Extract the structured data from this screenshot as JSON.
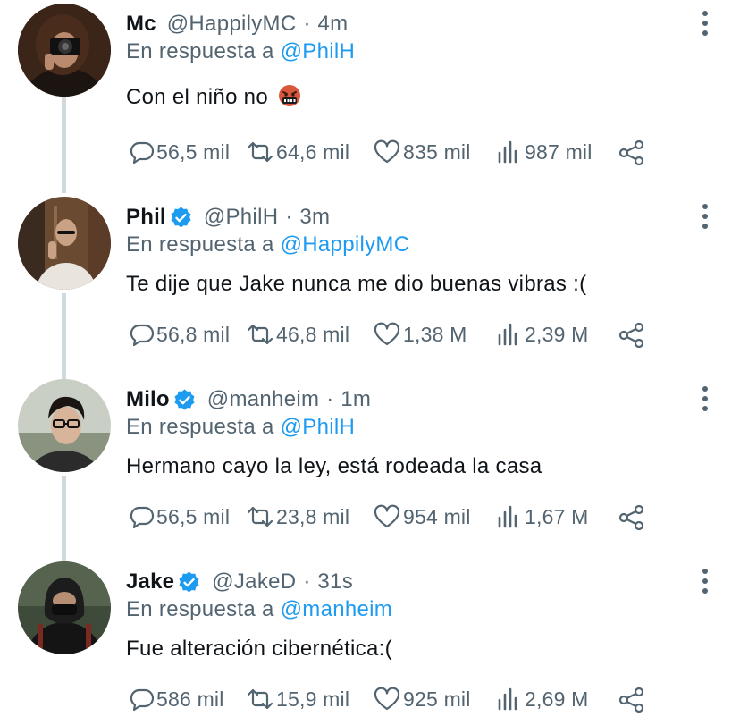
{
  "tweets": [
    {
      "name": "Mc",
      "verified": false,
      "handle": "@HappilyMC",
      "separator": "·",
      "time": "4m",
      "reply_prefix": "En respuesta a",
      "reply_to": "@PhilH",
      "text": "Con el niño no",
      "emoji": "face-with-symbols-on-mouth",
      "replies": "56,5 mil",
      "retweets": "64,6 mil",
      "likes": "835 mil",
      "views": "987 mil"
    },
    {
      "name": "Phil",
      "verified": true,
      "handle": "@PhilH",
      "separator": "·",
      "time": "3m",
      "reply_prefix": "En respuesta a",
      "reply_to": "@HappilyMC",
      "text": "Te dije que Jake nunca me dio buenas vibras :(",
      "replies": "56,8 mil",
      "retweets": "46,8 mil",
      "likes": "1,38 M",
      "views": "2,39 M"
    },
    {
      "name": "Milo",
      "verified": true,
      "handle": "@manheim",
      "separator": "·",
      "time": "1m",
      "reply_prefix": "En respuesta a",
      "reply_to": "@PhilH",
      "text": "Hermano cayo la ley, está rodeada la casa",
      "replies": "56,5 mil",
      "retweets": "23,8 mil",
      "likes": "954 mil",
      "views": "1,67 M"
    },
    {
      "name": "Jake",
      "verified": true,
      "handle": "@JakeD",
      "separator": "·",
      "time": "31s",
      "reply_prefix": "En respuesta a",
      "reply_to": "@manheim",
      "text": "Fue alteración cibernética:(",
      "replies": "586 mil",
      "retweets": "15,9 mil",
      "likes": "925 mil",
      "views": "2,69 M"
    }
  ],
  "icons": {
    "reply": "speech-bubble-icon",
    "retweet": "retweet-arrows-icon",
    "like": "heart-icon",
    "views": "bar-chart-icon",
    "share": "share-nodes-icon",
    "more": "vertical-ellipsis-icon",
    "verified": "verified-badge-icon"
  },
  "colors": {
    "link": "#1d9bf0",
    "secondary_text": "#536471",
    "primary_text": "#0f1419",
    "thread_line": "#cfd9de"
  }
}
